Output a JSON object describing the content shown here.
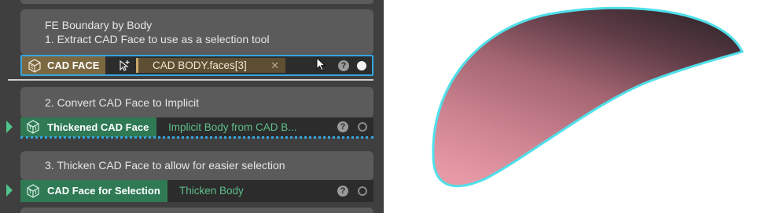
{
  "steps": {
    "step1": {
      "title": "FE Boundary by Body",
      "subtitle": "1. Extract CAD Face to use as a selection tool",
      "node_label": "CAD FACE",
      "field_value": "CAD BODY.faces[3]",
      "clear_glyph": "✕",
      "help_glyph": "?"
    },
    "step2": {
      "title": "2. Convert CAD Face to Implicit",
      "node_label": "Thickened CAD Face",
      "output": "Implicit Body from CAD B...",
      "help_glyph": "?"
    },
    "step3": {
      "title": "3. Thicken CAD Face to allow for easier selection",
      "node_label": "CAD Face for Selection",
      "output": "Thicken Body",
      "help_glyph": "?"
    }
  },
  "colors": {
    "selection_highlight": "#35a6e0",
    "node_green": "#2f7a55",
    "node_brown": "#7b6740",
    "surface_top": "#3a2a30",
    "surface_bottom": "#e79aa6",
    "surface_outline": "#4fe0ea"
  },
  "icons": [
    "cad-face-box-icon",
    "pick-selection-icon",
    "mouse-cursor-icon",
    "implicit-body-icon"
  ]
}
